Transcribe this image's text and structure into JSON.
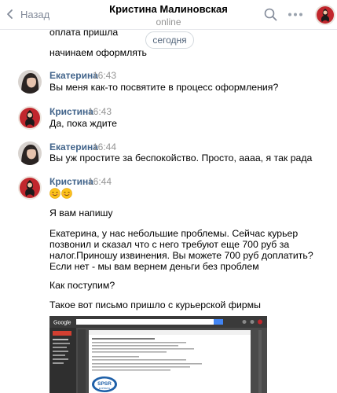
{
  "header": {
    "back_label": "Назад",
    "title": "Кристина Малиновская",
    "status": "online"
  },
  "date_separator": "сегодня",
  "messages": [
    {
      "text": "оплата пришла"
    },
    {
      "text": "начинаем оформлять"
    },
    {
      "author": "Екатерина",
      "time": "16:43",
      "lines": [
        "Вы меня как-то посвятите в процесс оформления?"
      ]
    },
    {
      "author": "Кристина",
      "time": "16:43",
      "lines": [
        "Да, пока ждите"
      ]
    },
    {
      "author": "Екатерина",
      "time": "16:44",
      "lines": [
        "Вы уж простите за беспокойство. Просто, аааа, я так рада"
      ]
    },
    {
      "author": "Кристина",
      "time": "16:44",
      "emoji": [
        "smiling-face-emoji",
        "smiling-face-emoji"
      ],
      "lines": [
        "Я вам напишу",
        "Екатерина, у нас небольшие проблемы. Сейчас курьер",
        "позвонил и сказал что с него требуют еще 700 руб за",
        "налог.Приношу извинения. Вы можете 700 руб доплатить?",
        "Если нет - мы вам вернем деньги без проблем",
        "Как поступим?",
        "Такое вот письмо пришло с курьерской фирмы"
      ]
    }
  ],
  "attachment": {
    "app_name": "Google",
    "logo_text": "SPSR",
    "logo_sub": "EXPRESS"
  },
  "colors": {
    "link": "#42648b",
    "muted": "#939393",
    "accent_avatar": "#c1272d"
  }
}
